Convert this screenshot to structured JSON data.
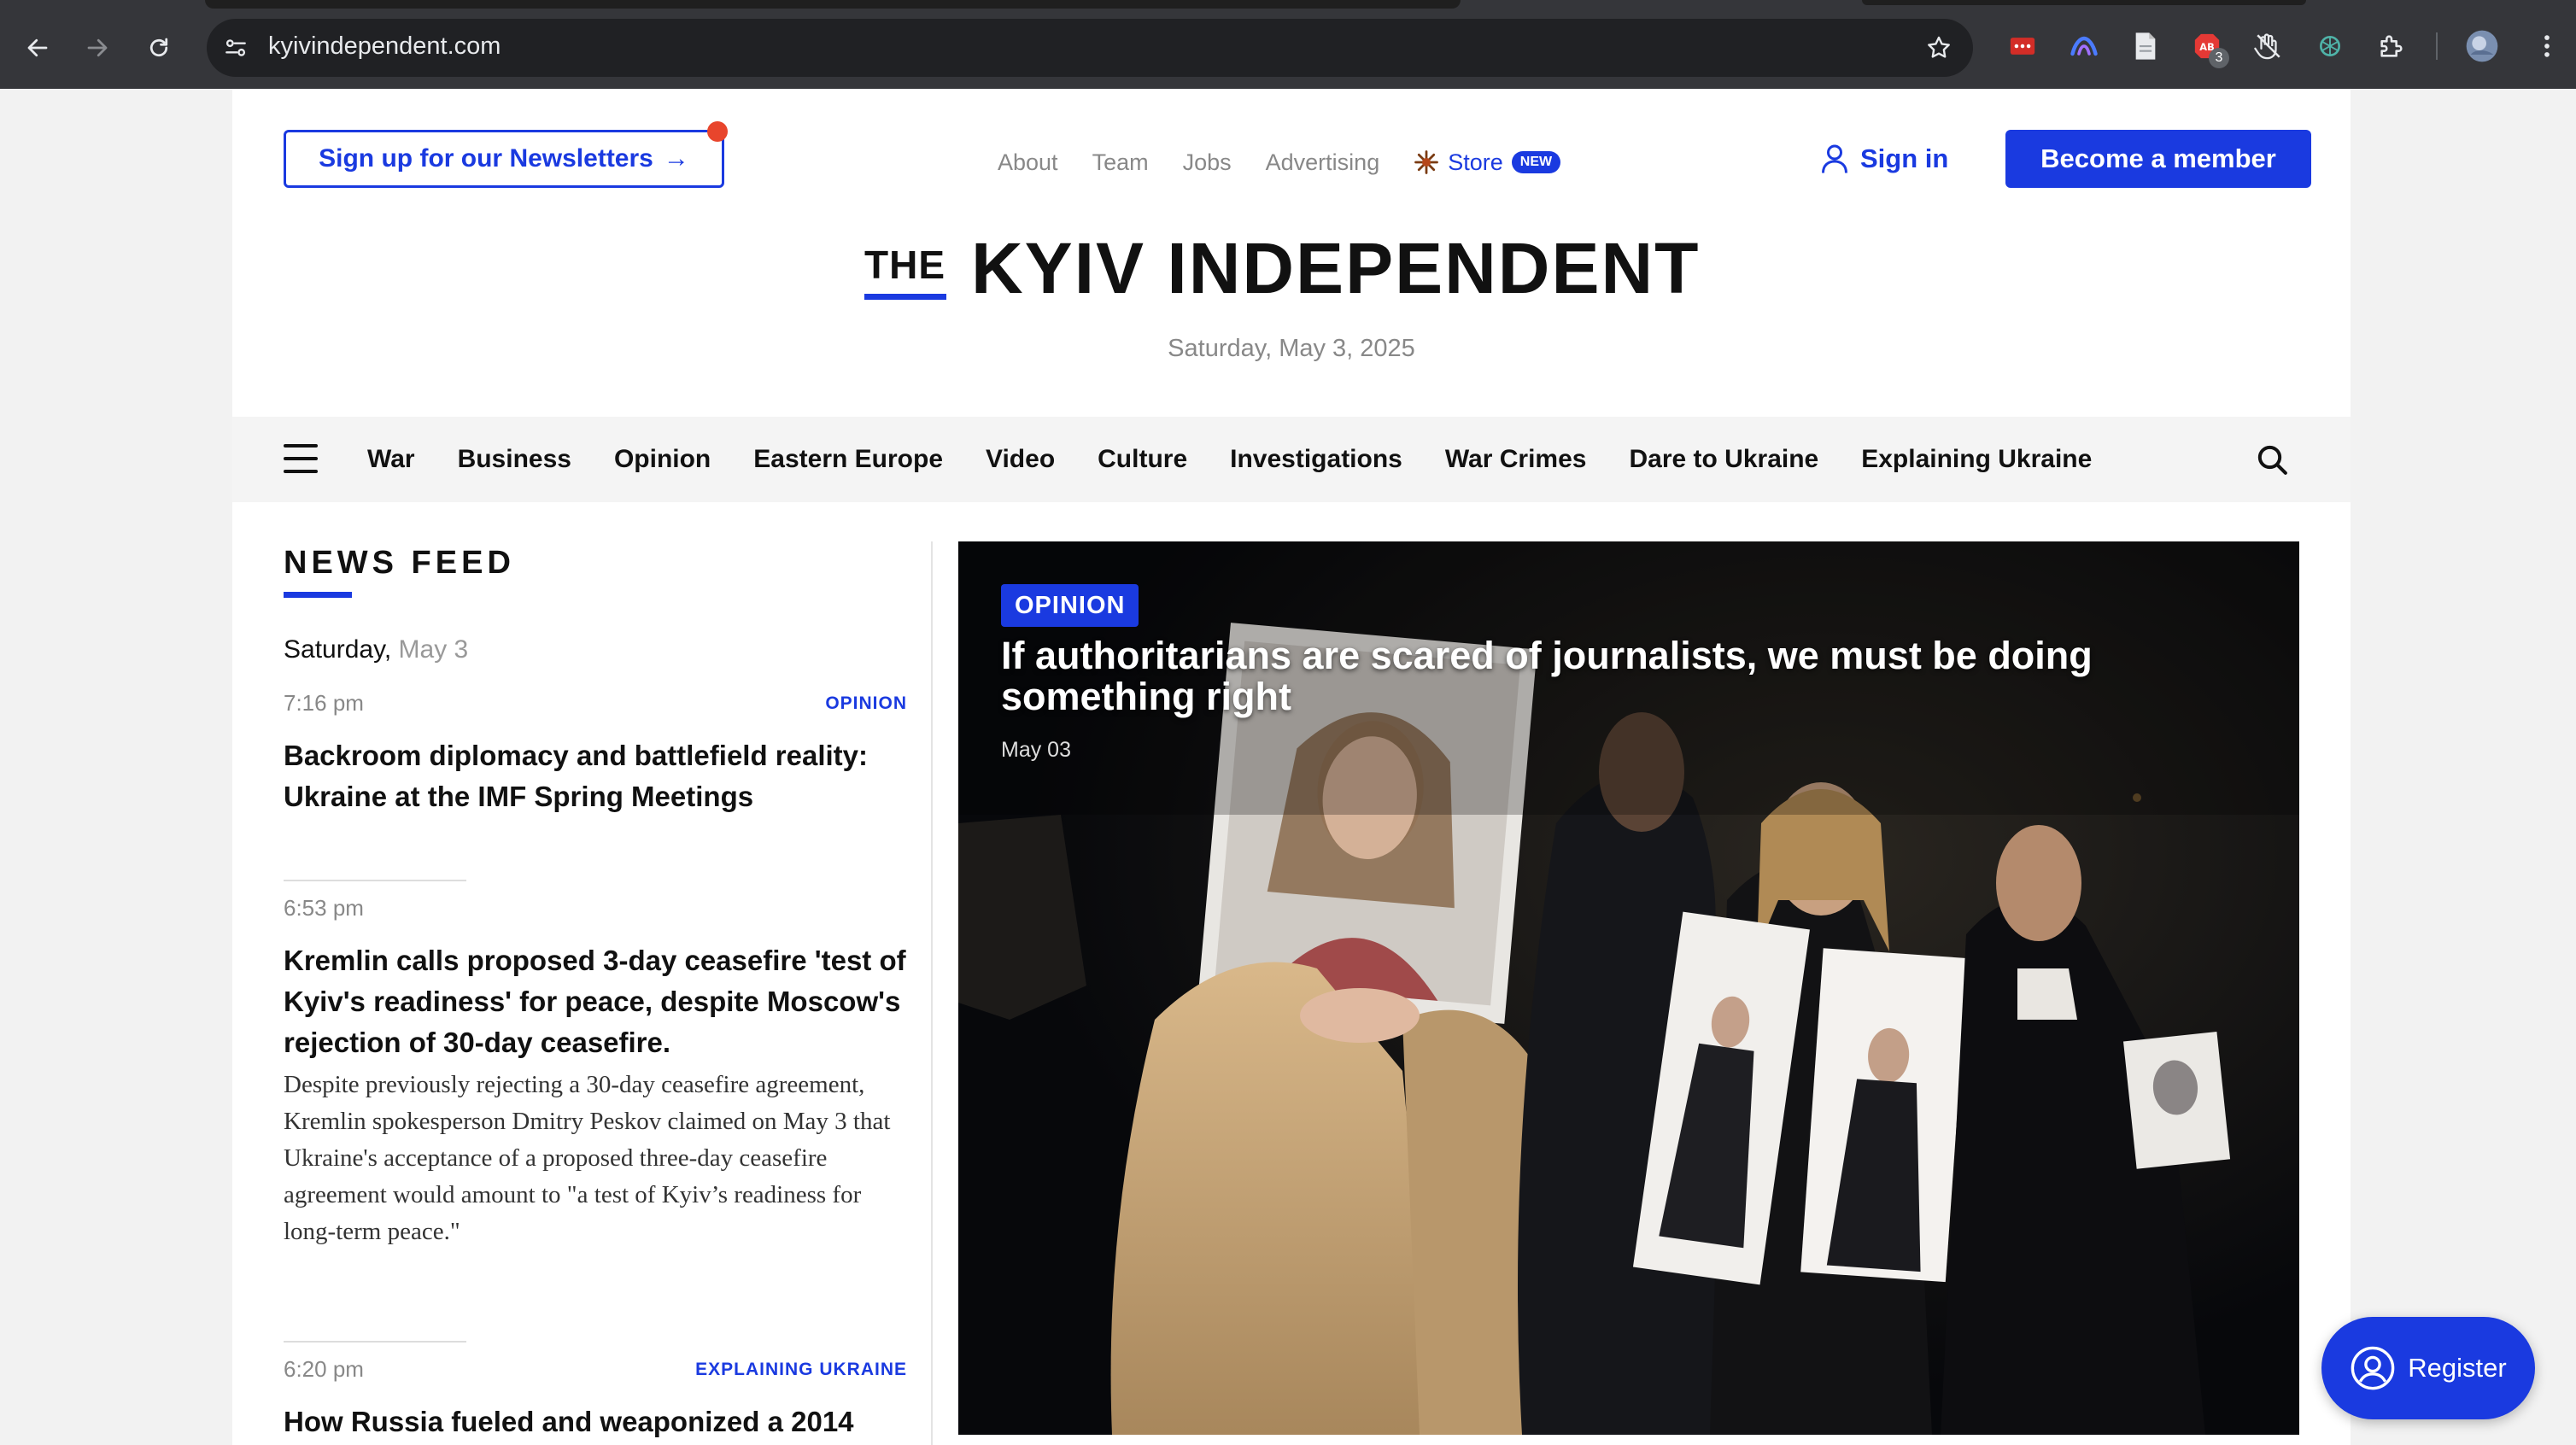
{
  "browser": {
    "url": "kyivindependent.com",
    "extension_badge": "3"
  },
  "header": {
    "newsletter_label": "Sign up for our Newsletters",
    "newsletter_arrow": "→",
    "top_links": [
      "About",
      "Team",
      "Jobs",
      "Advertising"
    ],
    "store_label": "Store",
    "store_badge": "NEW",
    "signin_label": "Sign in",
    "member_label": "Become a member",
    "logo_the": "THE",
    "logo_name": "KYIV INDEPENDENT",
    "date": "Saturday, May 3, 2025"
  },
  "nav": {
    "items": [
      "War",
      "Business",
      "Opinion",
      "Eastern Europe",
      "Video",
      "Culture",
      "Investigations",
      "War Crimes",
      "Dare to Ukraine",
      "Explaining Ukraine"
    ]
  },
  "feed": {
    "title": "NEWS FEED",
    "day_label": "Saturday,",
    "day_date": "May 3",
    "items": [
      {
        "time": "7:16 pm",
        "category": "OPINION",
        "headline": "Backroom diplomacy and battlefield reality: Ukraine at the IMF Spring Meetings",
        "excerpt": ""
      },
      {
        "time": "6:53 pm",
        "category": "",
        "headline": "Kremlin calls proposed 3-day ceasefire 'test of Kyiv's readiness' for peace, despite Moscow's rejection of 30-day ceasefire.",
        "excerpt": "Despite previously rejecting a 30-day ceasefire agreement, Kremlin spokesperson Dmitry Peskov claimed on May 3 that Ukraine's acceptance of a proposed three-day ceasefire agreement would amount to \"a test of Kyiv’s readiness for long-term peace.\""
      },
      {
        "time": "6:20 pm",
        "category": "EXPLAINING UKRAINE",
        "headline": "How Russia fueled and weaponized a 2014",
        "excerpt": ""
      }
    ]
  },
  "hero": {
    "category": "OPINION",
    "title": "If authoritarians are scared of journalists, we must be doing something right",
    "date": "May 03"
  },
  "register_label": "Register",
  "colors": {
    "accent": "#1a3ae0",
    "notification_dot": "#e8452c",
    "chrome_bg": "#35363a"
  }
}
